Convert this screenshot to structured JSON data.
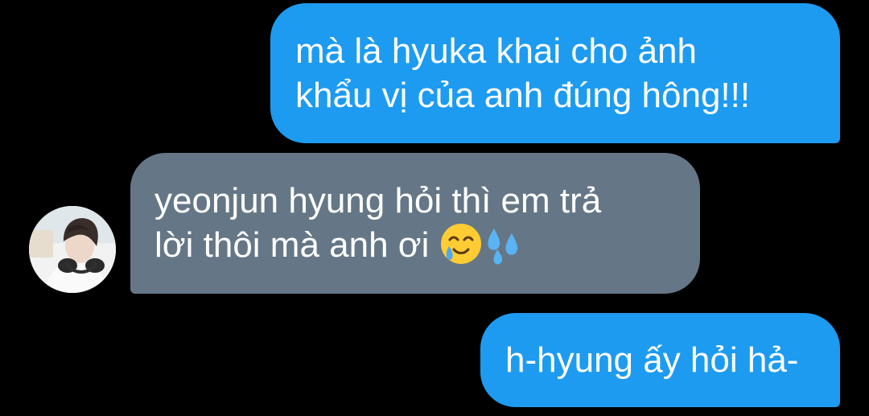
{
  "conversation": {
    "messages": [
      {
        "direction": "sent",
        "lines": [
          "mà là hyuka khai cho ảnh",
          "khẩu vị của anh đúng hông!!!"
        ]
      },
      {
        "direction": "received",
        "lines": [
          "yeonjun hyung hỏi thì em trả",
          "lời thôi mà anh ơi"
        ],
        "emojis": [
          "smiling-face-with-tear-emoji",
          "sweat-droplets-emoji"
        ]
      },
      {
        "direction": "sent",
        "lines": [
          "h-hyung ấy hỏi hả-"
        ]
      }
    ]
  },
  "colors": {
    "background": "#000000",
    "sent_bubble": "#1d9bf0",
    "received_bubble": "#657786",
    "text": "#ffffff"
  },
  "icons": {
    "avatar": "contact-avatar-photo"
  }
}
